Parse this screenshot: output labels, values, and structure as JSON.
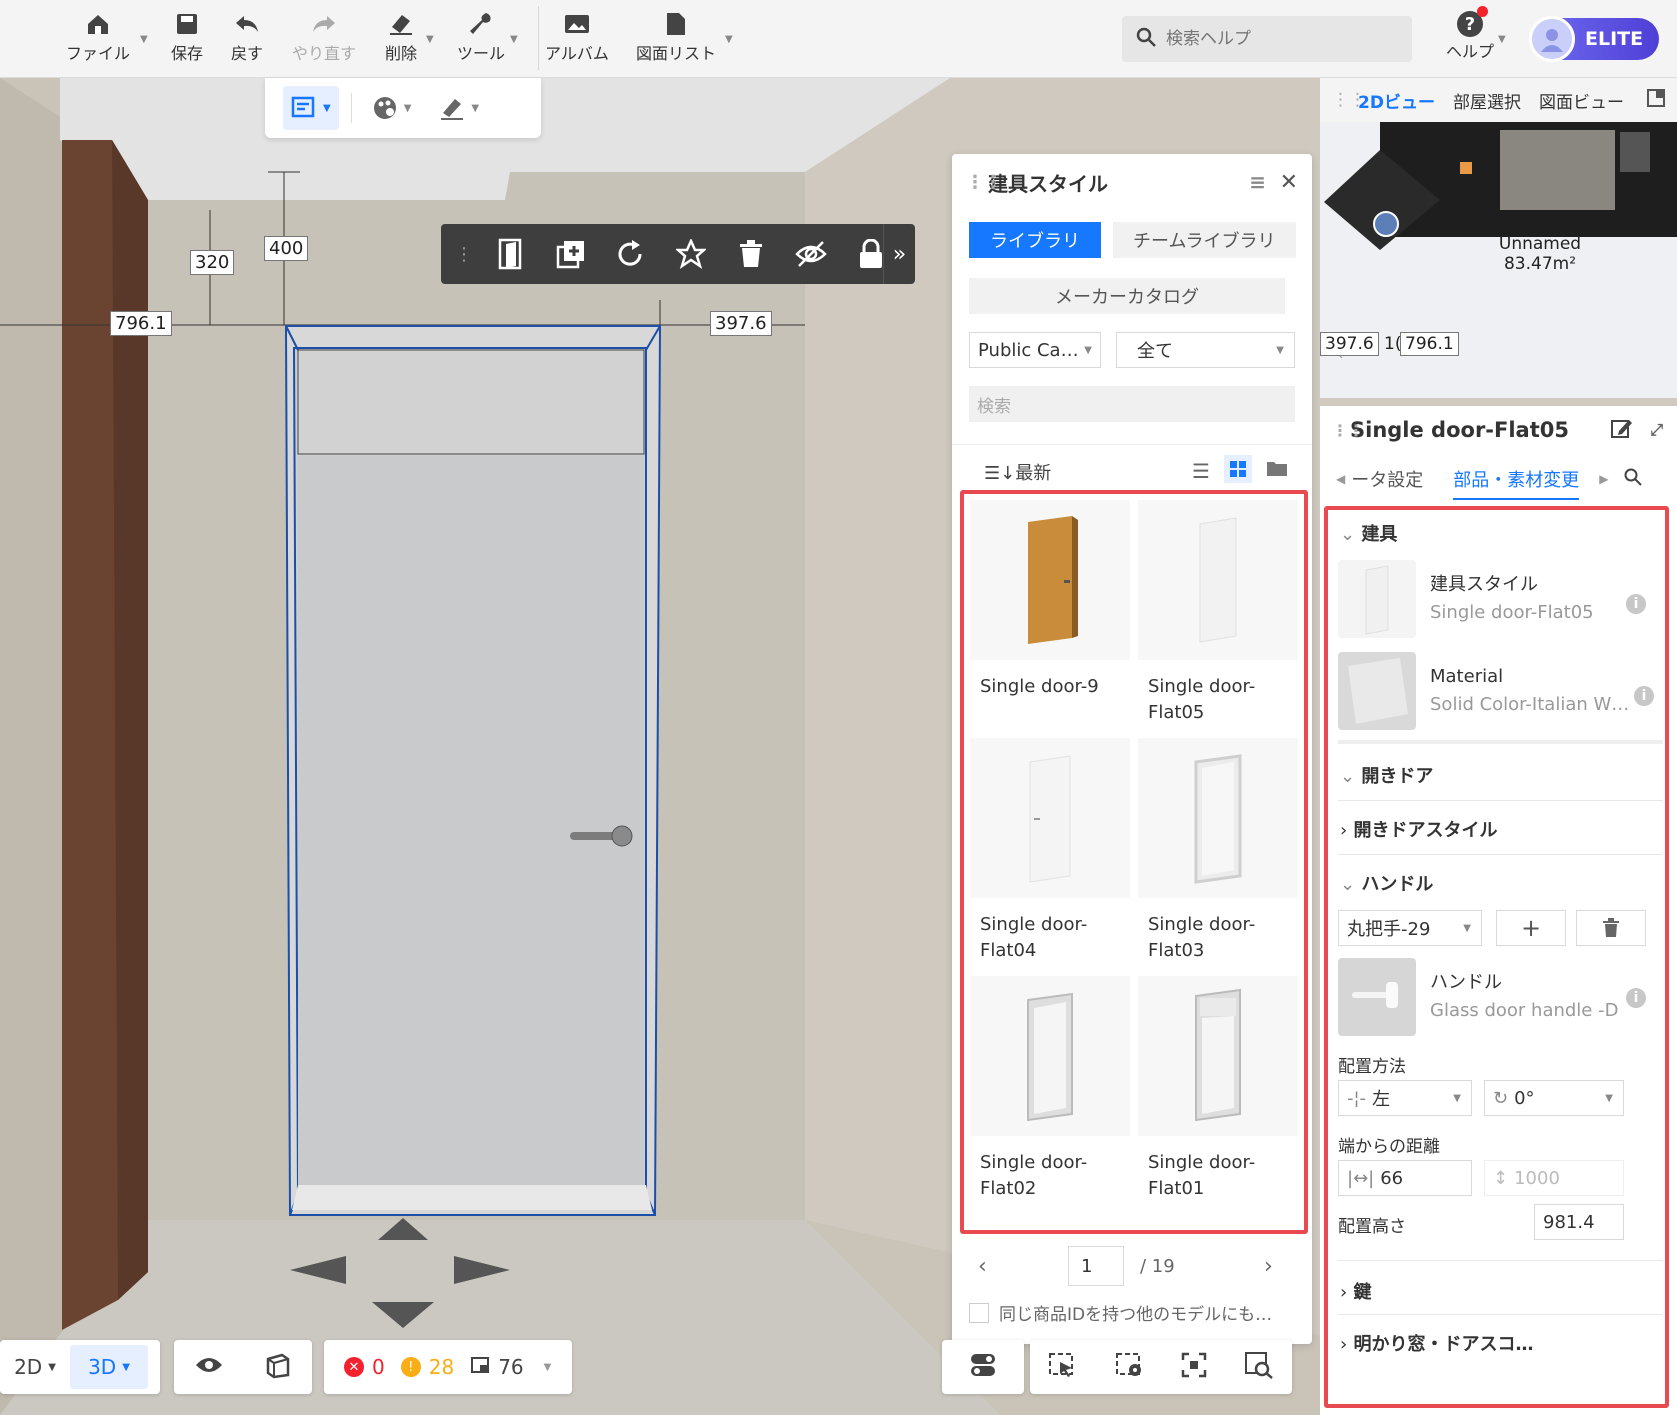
{
  "toolbar": {
    "file": "ファイル",
    "save": "保存",
    "undo": "戻す",
    "redo": "やり直す",
    "delete": "削除",
    "tools": "ツール",
    "album": "アルバム",
    "drawing_list": "図面リスト",
    "search_placeholder": "検索ヘルプ",
    "help": "ヘルプ",
    "badge": "ELITE"
  },
  "dimensions": {
    "d1": "320",
    "d2": "400",
    "d3": "796.1",
    "d4": "397.6"
  },
  "bottom": {
    "view2d": "2D",
    "view3d": "3D",
    "errors": "0",
    "warnings": "28",
    "items": "76"
  },
  "library": {
    "title": "建具スタイル",
    "tab_library": "ライブラリ",
    "tab_team": "チームライブラリ",
    "maker_catalog": "メーカーカタログ",
    "select_catalog": "Public Ca…",
    "select_all": "全て",
    "search_placeholder": "検索",
    "sort": "最新",
    "items": [
      {
        "name": "Single door-9"
      },
      {
        "name": "Single door-Flat05"
      },
      {
        "name": "Single door-Flat04"
      },
      {
        "name": "Single door-Flat03"
      },
      {
        "name": "Single door-Flat02"
      },
      {
        "name": "Single door-Flat01"
      }
    ],
    "page": "1",
    "page_total": "/ 19",
    "same_id_text": "同じ商品IDを持つ他のモデルにも…"
  },
  "mini2d": {
    "tab_2d": "2Dビュー",
    "tab_room": "部屋選択",
    "tab_drawing": "図面ビュー",
    "room_name": "Unnamed",
    "room_area": "83.47m²",
    "dim_a": "397.6",
    "dim_b": "796.1",
    "dim_b_prefix": "1("
  },
  "props": {
    "title": "Single door-Flat05",
    "tab_param": "ータ設定",
    "tab_parts": "部品・素材変更",
    "sec_fixture": "建具",
    "fixture_style_label": "建具スタイル",
    "fixture_style_value": "Single door-Flat05",
    "material_label": "Material",
    "material_value": "Solid Color-Italian W…",
    "sec_open_door": "開きドア",
    "open_door_style": "開きドアスタイル",
    "sec_handle": "ハンドル",
    "handle_select": "丸把手-29",
    "handle_label": "ハンドル",
    "handle_value": "Glass door handle -D",
    "placement_label": "配置方法",
    "placement_side": "左",
    "placement_angle": "0°",
    "edge_distance_label": "端からの距離",
    "edge_distance_value": "66",
    "edge_distance_placeholder": "1000",
    "height_label": "配置高さ",
    "height_value": "981.4",
    "sec_lock": "鍵",
    "sec_transom": "明かり窓・ドアスコ…"
  }
}
